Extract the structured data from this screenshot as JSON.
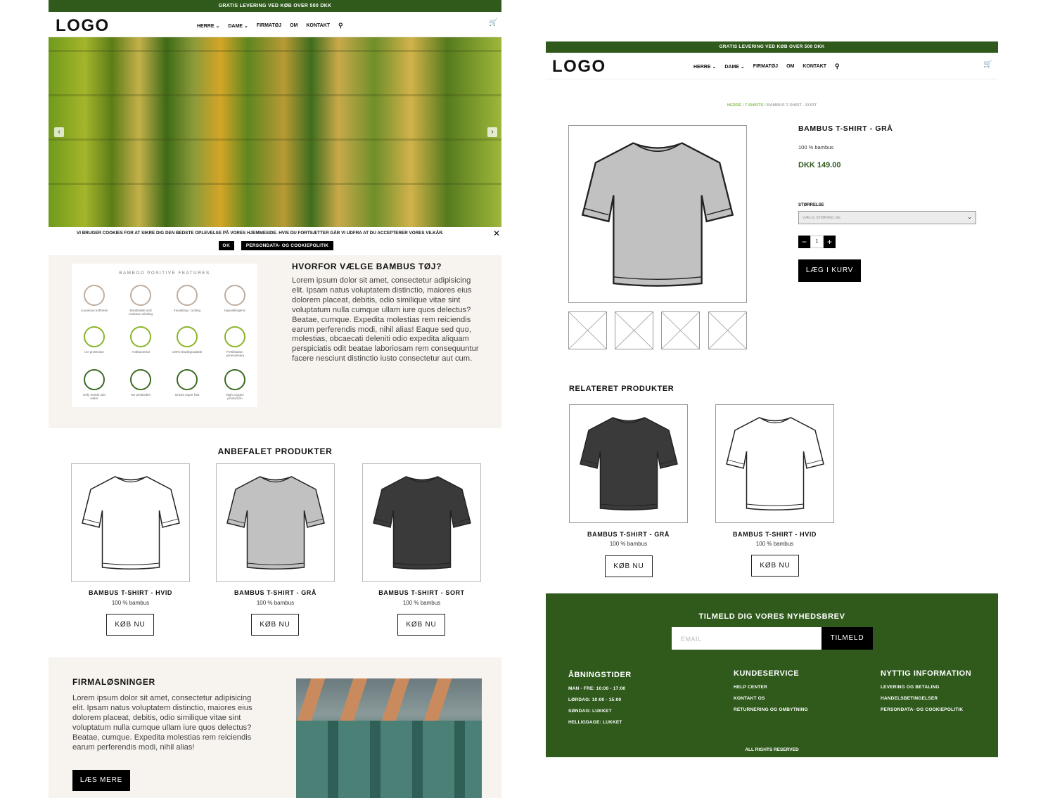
{
  "colors": {
    "brand_green": "#2f5a1c",
    "accent_light_green": "#8ac34a",
    "beige": "#f7f3ee",
    "black": "#000000"
  },
  "shared": {
    "topbar": "GRATIS LEVERING VED KØB OVER 500 DKK",
    "logo": "LOGO",
    "nav": [
      "HERRE",
      "DAME",
      "FIRMATØJ",
      "OM",
      "KONTAKT"
    ],
    "icons": {
      "search": "search-icon",
      "cart": "cart-icon",
      "chevron": "chevron-down-icon"
    }
  },
  "home": {
    "cookie_text": "VI BRUGER COOKIES FOR AT SIKRE DIG DEN BEDSTE OPLEVELSE PÅ VORES HJEMMESIDE. HVIS DU FORTSÆTTER GÅR VI UDFRA AT DU ACCEPTERER VORES VILKÅR.",
    "cookie_ok": "OK",
    "cookie_policy": "PERSONDATA- OG COOKIEPOLITIK",
    "infographic": {
      "title": "BAMBOO POSITIVE FEATURES",
      "features": [
        {
          "label": "Luxurious softness",
          "color": "#bfae9f"
        },
        {
          "label": "Breathable and moisture wicking",
          "color": "#bfae9f"
        },
        {
          "label": "Insulating / cooling",
          "color": "#bfae9f"
        },
        {
          "label": "Hypoallergenic",
          "color": "#bfae9f"
        },
        {
          "label": "UV protection",
          "color": "#8ab527"
        },
        {
          "label": "Antibacterial",
          "color": "#8ab527"
        },
        {
          "label": "100% Biodegradable",
          "color": "#8ab527"
        },
        {
          "label": "Fertilisation unnecessary",
          "color": "#8ab527"
        },
        {
          "label": "Only needs rain water",
          "color": "#3c6a23"
        },
        {
          "label": "No pesticides",
          "color": "#3c6a23"
        },
        {
          "label": "Grows super fast",
          "color": "#3c6a23"
        },
        {
          "label": "High oxygen production",
          "color": "#3c6a23"
        }
      ]
    },
    "why_title": "HVORFOR VÆLGE BAMBUS TØJ?",
    "why_text": "Lorem ipsum dolor sit amet, consectetur adipisicing elit. Ipsam natus voluptatem distinctio, maiores eius dolorem placeat, debitis, odio similique vitae sint voluptatum nulla cumque ullam iure quos delectus? Beatae, cumque. Expedita molestias rem reiciendis earum perferendis modi, nihil alias! Eaque sed quo, molestias, obcaecati deleniti odio expedita aliquam perspiciatis odit beatae laboriosam rem consequuntur facere nesciunt distinctio iusto consectetur aut cum.",
    "recommended_title": "ANBEFALET PRODUKTER",
    "products": [
      {
        "name": "BAMBUS T-SHIRT - HVID",
        "sub": "100 % bambus",
        "button": "KØB NU",
        "color": "#ffffff"
      },
      {
        "name": "BAMBUS T-SHIRT - GRÅ",
        "sub": "100 % bambus",
        "button": "KØB NU",
        "color": "#c1c1c1"
      },
      {
        "name": "BAMBUS T-SHIRT - SORT",
        "sub": "100 % bambus",
        "button": "KØB NU",
        "color": "#3a3a3a"
      }
    ],
    "firm_title": "FIRMALØSNINGER",
    "firm_text": "Lorem ipsum dolor sit amet, consectetur adipisicing elit. Ipsam natus voluptatem distinctio, maiores eius dolorem placeat, debitis, odio similique vitae sint voluptatum nulla cumque ullam iure quos delectus? Beatae, cumque. Expedita molestias rem reiciendis earum perferendis modi, nihil alias!",
    "firm_button": "LÆS MERE"
  },
  "product_page": {
    "breadcrumb": [
      "HERRE",
      "T-SHIRTS",
      "BAMBUS T-SHIRT - SORT"
    ],
    "title": "BAMBUS T-SHIRT - GRÅ",
    "material": "100 % bambus",
    "price": "DKK 149.00",
    "size_label": "STØRRELSE",
    "size_placeholder": "VÆLG STØRRELSE",
    "quantity": "1",
    "add_to_cart": "LÆG I KURV",
    "main_color": "#c1c1c1",
    "related_title": "RELATERET PRODUKTER",
    "related": [
      {
        "name": "BAMBUS T-SHIRT - GRÅ",
        "sub": "100 % bambus",
        "button": "KØB NU",
        "color": "#3a3a3a"
      },
      {
        "name": "BAMBUS T-SHIRT - HVID",
        "sub": "100 % bambus",
        "button": "KØB NU",
        "color": "#ffffff"
      }
    ]
  },
  "footer": {
    "newsletter_title": "TILMELD DIG VORES NYHEDSBREV",
    "email_placeholder": "EMAIL",
    "subscribe": "TILMELD",
    "hours_title": "ÅBNINGSTIDER",
    "hours": [
      "MAN - FRE: 10:00 - 17:00",
      "LØRDAG: 10:00 - 15:00",
      "SØNDAG: LUKKET",
      "HELLIGDAGE: LUKKET"
    ],
    "service_title": "KUNDESERVICE",
    "service": [
      "HELP CENTER",
      "KONTAKT OS",
      "RETURNERING OG OMBYTNING"
    ],
    "info_title": "NYTTIG INFORMATION",
    "info": [
      "LEVERING OG BETALING",
      "HANDELSBETINGELSER",
      "PERSONDATA- OG COOKIEPOLITIK"
    ],
    "rights": "ALL RIGHTS RESERVED"
  }
}
